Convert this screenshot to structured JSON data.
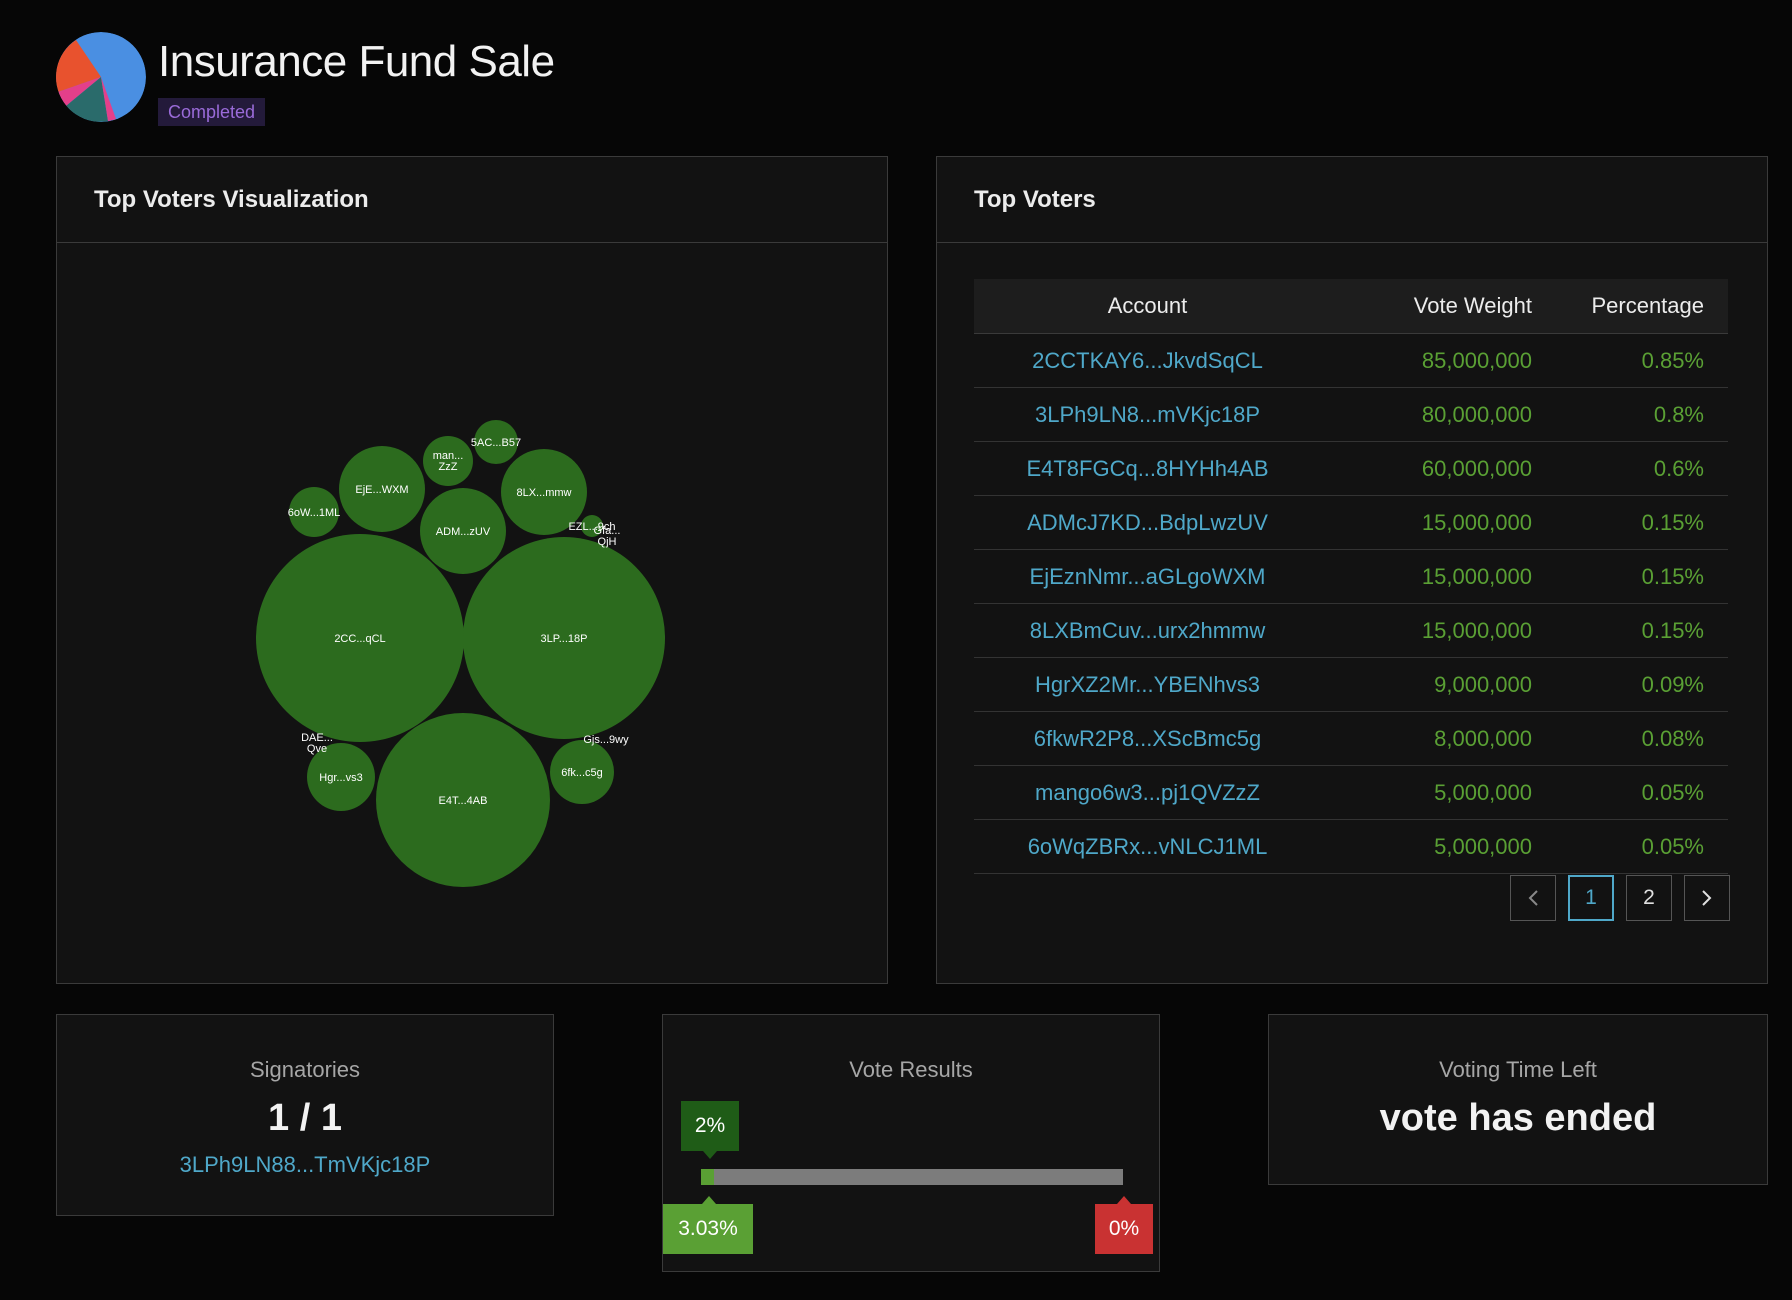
{
  "header": {
    "title": "Insurance Fund Sale",
    "status": "Completed",
    "avatar_colors": [
      "#4a8fe2",
      "#e8522e",
      "#e43f8a",
      "#2a6b6b"
    ]
  },
  "viz": {
    "title": "Top Voters Visualization",
    "bubble_color": "#2c6b1e",
    "bubbles": [
      {
        "label": "2CC...qCL",
        "weight": 85000000
      },
      {
        "label": "3LP...18P",
        "weight": 80000000
      },
      {
        "label": "E4T...4AB",
        "weight": 60000000
      },
      {
        "label": "ADM...zUV",
        "weight": 15000000
      },
      {
        "label": "EjE...WXM",
        "weight": 15000000
      },
      {
        "label": "8LX...mmw",
        "weight": 15000000
      },
      {
        "label": "Hgr...vs3",
        "weight": 9000000
      },
      {
        "label": "6fk...c5g",
        "weight": 8000000
      },
      {
        "label": "man... ZzZ",
        "weight": 5000000
      },
      {
        "label": "6oW...1ML",
        "weight": 5000000
      },
      {
        "label": "5AC...B57",
        "weight": 4000000
      },
      {
        "label": "EZL...9ch",
        "weight": 1000000
      },
      {
        "label": "Gfa... QjH",
        "weight": 0
      },
      {
        "label": "DAE... Qve",
        "weight": 0
      },
      {
        "label": "Gjs...9wy",
        "weight": 0
      }
    ]
  },
  "voters": {
    "title": "Top Voters",
    "headers": {
      "account": "Account",
      "weight": "Vote Weight",
      "percentage": "Percentage"
    },
    "rows": [
      {
        "account": "2CCTKAY6...JkvdSqCL",
        "weight": "85,000,000",
        "percentage": "0.85%"
      },
      {
        "account": "3LPh9LN8...mVKjc18P",
        "weight": "80,000,000",
        "percentage": "0.8%"
      },
      {
        "account": "E4T8FGCq...8HYHh4AB",
        "weight": "60,000,000",
        "percentage": "0.6%"
      },
      {
        "account": "ADMcJ7KD...BdpLwzUV",
        "weight": "15,000,000",
        "percentage": "0.15%"
      },
      {
        "account": "EjEznNmr...aGLgoWXM",
        "weight": "15,000,000",
        "percentage": "0.15%"
      },
      {
        "account": "8LXBmCuv...urx2hmmw",
        "weight": "15,000,000",
        "percentage": "0.15%"
      },
      {
        "account": "HgrXZ2Mr...YBENhvs3",
        "weight": "9,000,000",
        "percentage": "0.09%"
      },
      {
        "account": "6fkwR2P8...XScBmc5g",
        "weight": "8,000,000",
        "percentage": "0.08%"
      },
      {
        "account": "mango6w3...pj1QVZzZ",
        "weight": "5,000,000",
        "percentage": "0.05%"
      },
      {
        "account": "6oWqZBRx...vNLCJ1ML",
        "weight": "5,000,000",
        "percentage": "0.05%"
      }
    ],
    "pagination": {
      "pages": [
        "1",
        "2"
      ],
      "current": "1"
    }
  },
  "signatories": {
    "label": "Signatories",
    "value": "1 / 1",
    "address": "3LPh9LN88...TmVKjc18P"
  },
  "vote_results": {
    "label": "Vote Results",
    "quorum_label": "2%",
    "quorum_fraction": 0.02,
    "yes_label": "3.03%",
    "yes_fraction": 0.0303,
    "no_label": "0%",
    "no_fraction": 0
  },
  "time_left": {
    "label": "Voting Time Left",
    "value": "vote has ended"
  },
  "colors": {
    "link": "#4fa8c9",
    "positive": "#5aa034",
    "negative": "#c93232",
    "accent_badge": "#9a6bd9"
  }
}
